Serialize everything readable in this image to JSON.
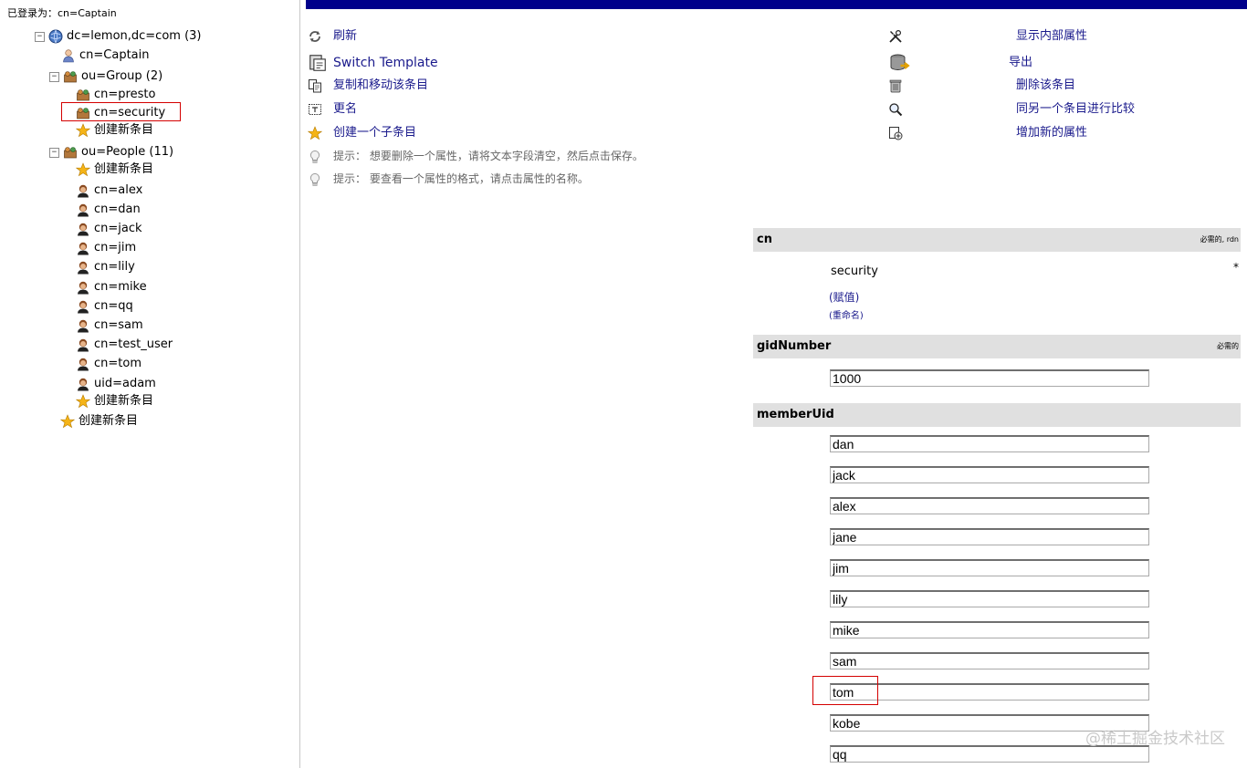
{
  "login": {
    "text": "已登录为：cn=Captain"
  },
  "tree": {
    "root_label": "dc=lemon,dc=com (3)",
    "captain_label": "cn=Captain",
    "group_label": "ou=Group (2)",
    "group_items": [
      "cn=presto",
      "cn=security"
    ],
    "create_label": "创建新条目",
    "people_label": "ou=People (11)",
    "people_items": [
      "cn=alex",
      "cn=dan",
      "cn=jack",
      "cn=jim",
      "cn=lily",
      "cn=mike",
      "cn=qq",
      "cn=sam",
      "cn=test_user",
      "cn=tom",
      "uid=adam"
    ],
    "toggle_minus": "−"
  },
  "actions": {
    "refresh": "刷新",
    "switch_template": "Switch Template",
    "copy_move": "复制和移动该条目",
    "rename": "更名",
    "create_child": "创建一个子条目",
    "show_internal": "显示内部属性",
    "export": "导出",
    "delete": "删除该条目",
    "compare": "同另一个条目进行比较",
    "add_attribute": "增加新的属性"
  },
  "hints": {
    "hint1": "提示： 想要删除一个属性，请将文本字段清空，然后点击保存。",
    "hint2": "提示： 要查看一个属性的格式，请点击属性的名称。"
  },
  "attributes": {
    "cn": {
      "name": "cn",
      "flags": "必需的, rdn",
      "value": "security",
      "star": "*",
      "assign": "(赋值)",
      "rename": "(重命名)"
    },
    "gidNumber": {
      "name": "gidNumber",
      "flags": "必需的",
      "value": "1000"
    },
    "memberUid": {
      "name": "memberUid",
      "values": [
        "dan",
        "jack",
        "alex",
        "jane",
        "jim",
        "lily",
        "mike",
        "sam",
        "tom",
        "kobe",
        "qq"
      ]
    }
  },
  "watermark": "@稀土掘金技术社区",
  "colors": {
    "topbar": "#00008b",
    "link": "#1a1a8c",
    "attr_header": "#e0e0e0",
    "highlight": "#d40000"
  }
}
